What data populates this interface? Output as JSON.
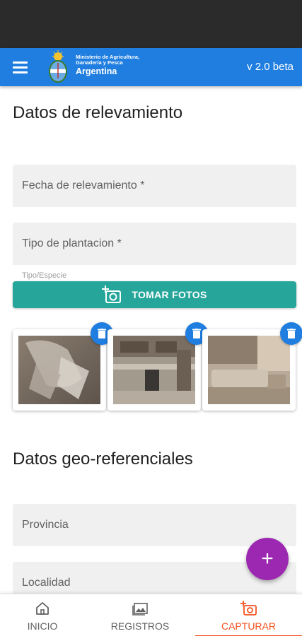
{
  "header": {
    "menu_icon": "menu-icon",
    "ministry_line1": "Ministerio de Agricultura,",
    "ministry_line2": "Ganadería y Pesca",
    "ministry_line3": "Argentina",
    "version": "v 2.0 beta"
  },
  "section1": {
    "title": "Datos de relevamiento"
  },
  "fields": {
    "fecha_placeholder": "Fecha de relevamiento *",
    "tipo_placeholder": "Tipo de plantacion *",
    "tipo_hint": "Tipo/Especie",
    "provincia_placeholder": "Provincia",
    "localidad_placeholder": "Localidad"
  },
  "photo_button": {
    "label": "TOMAR FOTOS",
    "icon": "add-photo-icon"
  },
  "photos": [
    {
      "name": "photo-1",
      "delete_icon": "trash-icon"
    },
    {
      "name": "photo-2",
      "delete_icon": "trash-icon"
    },
    {
      "name": "photo-3",
      "delete_icon": "trash-icon"
    }
  ],
  "section2": {
    "title": "Datos geo-referenciales"
  },
  "fab": {
    "label": "+"
  },
  "bottom_nav": [
    {
      "label": "INICIO",
      "icon": "home-icon",
      "active": false
    },
    {
      "label": "REGISTROS",
      "icon": "gallery-icon",
      "active": false
    },
    {
      "label": "CAPTURAR",
      "icon": "add-photo-icon",
      "active": true
    }
  ],
  "colors": {
    "app_bar": "#1f7ee0",
    "photo_button": "#26a69a",
    "fab": "#9c27b0",
    "active_nav": "#f4511e",
    "field_bg": "#f0f0f0"
  }
}
